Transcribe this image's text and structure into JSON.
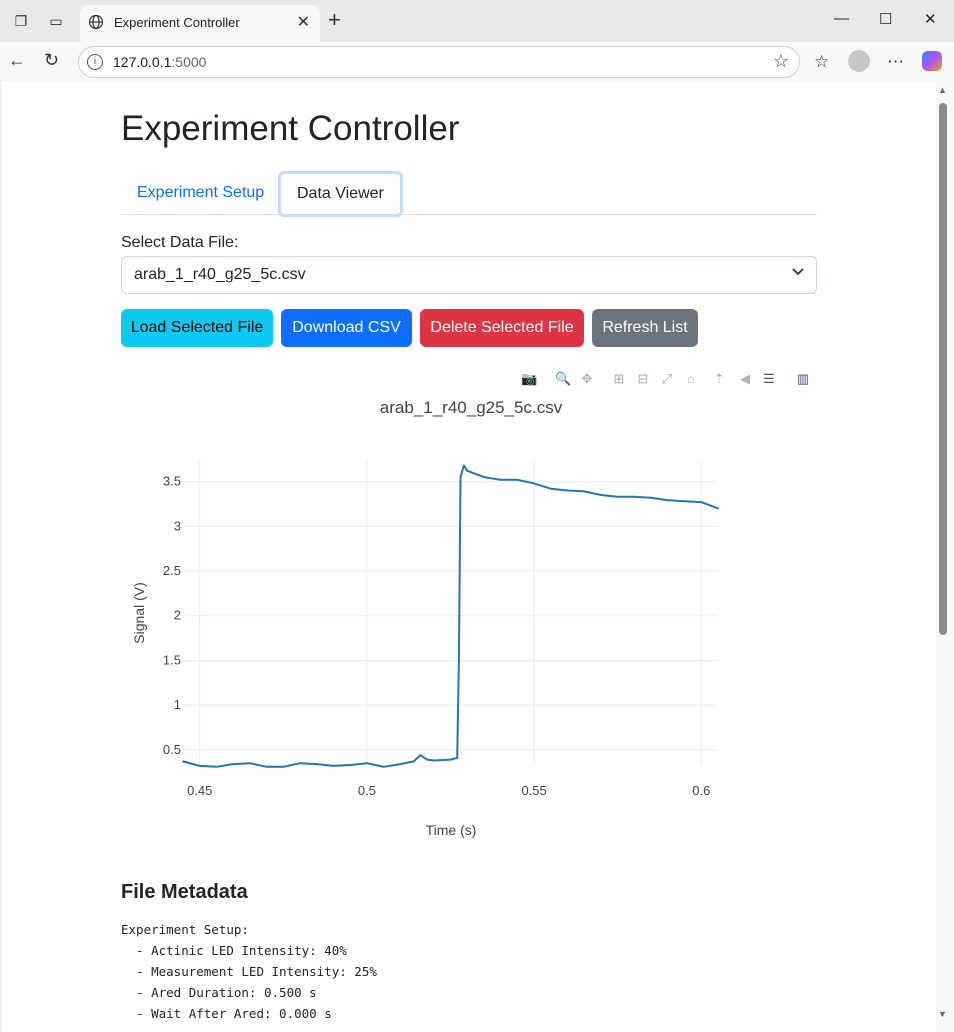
{
  "browser": {
    "tab_title": "Experiment Controller",
    "url_host": "127.0.0.1",
    "url_port": ":5000"
  },
  "page": {
    "title": "Experiment Controller",
    "tabs": [
      {
        "label": "Experiment Setup",
        "active": false
      },
      {
        "label": "Data Viewer",
        "active": true
      }
    ],
    "select_label": "Select Data File:",
    "selected_file": "arab_1_r40_g25_5c.csv",
    "buttons": {
      "load": "Load Selected File",
      "download": "Download CSV",
      "delete": "Delete Selected File",
      "refresh": "Refresh List"
    },
    "metadata_heading": "File Metadata",
    "metadata_lines": [
      "Experiment Setup:",
      "  - Actinic LED Intensity: 40%",
      "  - Measurement LED Intensity: 25%",
      "  - Ared Duration: 0.500 s",
      "  - Wait After Ared: 0.000 s"
    ]
  },
  "colors": {
    "primary": "#0d6efd",
    "info": "#0dcaf0",
    "danger": "#dc3545",
    "secondary": "#6c757d",
    "trace": "#1f77b4"
  },
  "chart_data": {
    "type": "line",
    "title": "arab_1_r40_g25_5c.csv",
    "xlabel": "Time (s)",
    "ylabel": "Signal (V)",
    "xlim": [
      0.445,
      0.605
    ],
    "ylim": [
      0.33,
      3.73
    ],
    "xticks": [
      0.45,
      0.5,
      0.55,
      0.6
    ],
    "xtick_labels": [
      "0.45",
      "0.5",
      "0.55",
      "0.6"
    ],
    "yticks": [
      0.5,
      1,
      1.5,
      2,
      2.5,
      3,
      3.5
    ],
    "ytick_labels": [
      "0.5",
      "1",
      "1.5",
      "2",
      "2.5",
      "3",
      "3.5"
    ],
    "grid": true,
    "series": [
      {
        "x": [
          0.445,
          0.45,
          0.455,
          0.46,
          0.465,
          0.47,
          0.475,
          0.48,
          0.485,
          0.49,
          0.495,
          0.5,
          0.505,
          0.51,
          0.514,
          0.516,
          0.518,
          0.52,
          0.525,
          0.527,
          0.5275,
          0.528,
          0.529,
          0.53,
          0.535,
          0.54,
          0.545,
          0.55,
          0.555,
          0.56,
          0.565,
          0.57,
          0.575,
          0.58,
          0.585,
          0.59,
          0.595,
          0.6,
          0.605
        ],
        "y": [
          0.37,
          0.32,
          0.31,
          0.34,
          0.35,
          0.31,
          0.31,
          0.35,
          0.34,
          0.32,
          0.33,
          0.35,
          0.31,
          0.34,
          0.37,
          0.44,
          0.39,
          0.38,
          0.39,
          0.41,
          1.5,
          3.55,
          3.68,
          3.62,
          3.55,
          3.52,
          3.52,
          3.48,
          3.42,
          3.4,
          3.39,
          3.35,
          3.33,
          3.33,
          3.32,
          3.29,
          3.28,
          3.27,
          3.2
        ]
      }
    ]
  }
}
